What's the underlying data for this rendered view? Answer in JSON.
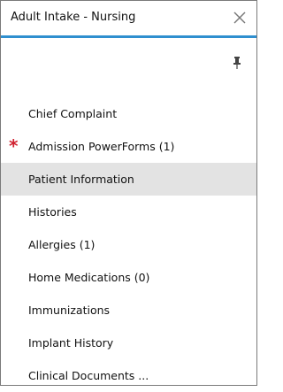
{
  "header": {
    "title": "Adult Intake - Nursing",
    "close_icon": "close-icon"
  },
  "toolbar": {
    "pin_icon": "pin-icon"
  },
  "nav": {
    "items": [
      {
        "label": "Chief Complaint"
      },
      {
        "label": "Admission PowerForms (1)",
        "required": true
      },
      {
        "label": "Patient Information",
        "selected": true
      },
      {
        "label": "Histories"
      },
      {
        "label": "Allergies (1)"
      },
      {
        "label": "Home Medications (0)"
      },
      {
        "label": "Immunizations"
      },
      {
        "label": "Implant History"
      },
      {
        "label": "Clinical Documents ..."
      }
    ],
    "required_marker": "*"
  },
  "colors": {
    "accent": "#2f8fcf",
    "required": "#d0212f",
    "selected_bg": "#e3e3e3"
  }
}
